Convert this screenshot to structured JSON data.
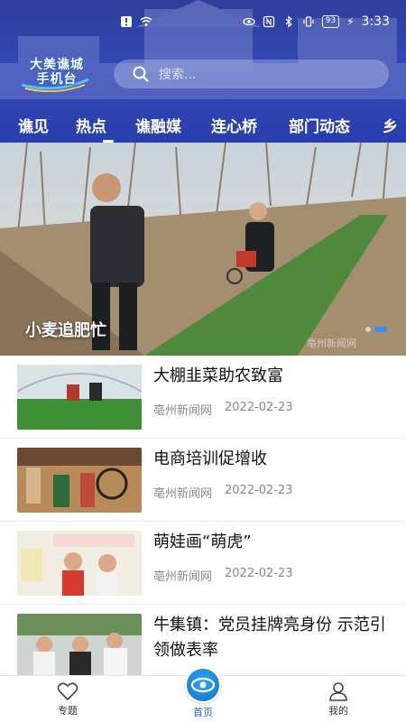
{
  "status_bar": {
    "battery": "93",
    "time": "3:33"
  },
  "header": {
    "logo_text_line1": "大美谯城",
    "logo_text_line2": "手机台",
    "search_placeholder": "搜索..."
  },
  "tabs": [
    {
      "label": "谯见"
    },
    {
      "label": "热点"
    },
    {
      "label": "谯融媒"
    },
    {
      "label": "连心桥"
    },
    {
      "label": "部门动态"
    },
    {
      "label": "乡"
    }
  ],
  "active_tab": "热点",
  "hero": {
    "caption": "小麦追肥忙",
    "watermark": "亳州新闻网",
    "slide_index": 2,
    "slide_count": 2
  },
  "news": [
    {
      "title": "大棚韭菜助农致富",
      "source": "亳州新闻网",
      "date": "2022-02-23"
    },
    {
      "title": "电商培训促增收",
      "source": "亳州新闻网",
      "date": "2022-02-23"
    },
    {
      "title": "萌娃画“萌虎”",
      "source": "亳州新闻网",
      "date": "2022-02-23"
    },
    {
      "title": "牛集镇：党员挂牌亮身份 示范引领做表率",
      "source": "",
      "date": ""
    }
  ],
  "bottom_nav": {
    "left_label": "专题",
    "center_label": "首页",
    "right_label": "我的"
  },
  "colors": {
    "header": "#3347b3",
    "accent": "#2a62d8",
    "text": "#111111",
    "meta": "#888888"
  }
}
